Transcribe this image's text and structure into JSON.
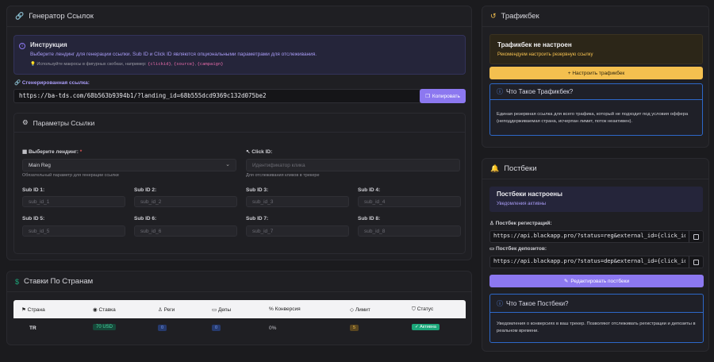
{
  "generator": {
    "title": "Генератор Ссылок",
    "instruction": {
      "title": "Инструкция",
      "text": "Выберите лендинг для генерации ссылки. Sub ID и Click ID являются опциональными параметрами для отслеживания.",
      "tip_prefix": "Используйте макросы в фигурных скобках, например:",
      "macros": [
        "{clickid}",
        "{source}",
        "{campaign}"
      ]
    },
    "generated_label": "Сгенерированная ссылка:",
    "generated_url": "https://ba-tds.com/68b563b9394b1/?landing_id=68b555dcd9369c132d075be2",
    "copy_label": "Копировать",
    "params": {
      "title": "Параметры Ссылки",
      "landing_label": "Выберите лендинг:",
      "landing_required": "*",
      "landing_value": "Main Reg",
      "landing_hint": "Обязательный параметр для генерации ссылки",
      "clickid_label": "Click ID:",
      "clickid_placeholder": "Идентификатор клика",
      "clickid_hint": "Для отслеживания кликов в трекере",
      "subs": [
        {
          "label": "Sub ID 1:",
          "placeholder": "sub_id_1"
        },
        {
          "label": "Sub ID 2:",
          "placeholder": "sub_id_2"
        },
        {
          "label": "Sub ID 3:",
          "placeholder": "sub_id_3"
        },
        {
          "label": "Sub ID 4:",
          "placeholder": "sub_id_4"
        },
        {
          "label": "Sub ID 5:",
          "placeholder": "sub_id_5"
        },
        {
          "label": "Sub ID 6:",
          "placeholder": "sub_id_6"
        },
        {
          "label": "Sub ID 7:",
          "placeholder": "sub_id_7"
        },
        {
          "label": "Sub ID 8:",
          "placeholder": "sub_id_8"
        }
      ]
    }
  },
  "rates": {
    "title": "Ставки По Странам",
    "columns": [
      "Страна",
      "Ставка",
      "Реги",
      "Депы",
      "Конверсия",
      "Лимит",
      "Статус"
    ],
    "rows": [
      {
        "country": "TR",
        "rate": "70 USD",
        "regs": "0",
        "deps": "0",
        "conversion": "0%",
        "limit": "5",
        "status": "Активна"
      }
    ]
  },
  "traffic": {
    "title": "Трафикбек",
    "alert_title": "Трафикбек не настроен",
    "alert_text": "Рекомендуем настроить резервную ссылку",
    "button": "+ Настроить трафикбек",
    "info_title": "Что Такое Трафикбек?",
    "info_text": "Единая резервная ссылка для всего трафика, который не подходит под условия оффера (неподдерживаемая страна, исчерпан лимит, поток неактивен)."
  },
  "postback": {
    "title": "Постбеки",
    "status_title": "Постбеки настроены",
    "status_text": "Уведомления активны",
    "reg_label": "Постбек регистраций:",
    "reg_url": "https://api.blackapp.pro/?status=reg&external_id={click_id}",
    "dep_label": "Постбек депозитов:",
    "dep_url": "https://api.blackapp.pro/?status=dep&external_id={click_id}",
    "edit_button": "Редактировать постбеки",
    "info_title": "Что Такое Постбеки?",
    "info_text": "Уведомления о конверсиях в ваш трекер. Позволяют отслеживать регистрации и депозиты в реальном времени."
  },
  "colors": {
    "accent": "#8c78f0",
    "warning": "#f4c04f",
    "info_blue": "#2d68c8",
    "success": "#1ca77a"
  }
}
